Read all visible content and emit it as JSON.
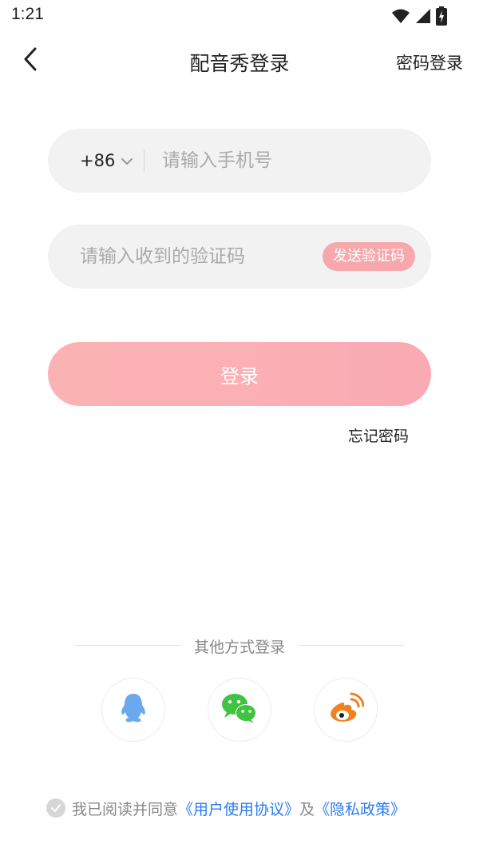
{
  "status_bar": {
    "time": "1:21"
  },
  "header": {
    "title": "配音秀登录",
    "right_action": "密码登录"
  },
  "form": {
    "country_code": "+86",
    "phone_placeholder": "请输入手机号",
    "code_placeholder": "请输入收到的验证码",
    "send_code_label": "发送验证码",
    "login_label": "登录",
    "forgot_label": "忘记密码"
  },
  "other_login": {
    "label": "其他方式登录",
    "providers": [
      "qq-icon",
      "wechat-icon",
      "weibo-icon"
    ]
  },
  "agreement": {
    "prefix": "我已阅读并同意",
    "user_agreement": "《用户使用协议》",
    "and": "及",
    "privacy_policy": "《隐私政策》"
  },
  "colors": {
    "accent_pink": "#f7a8ad",
    "login_gradient_start": "#fbb2b2",
    "login_gradient_end": "#f9aab3",
    "link_blue": "#2a7df0",
    "qq_blue": "#6aa9f0",
    "wechat_green": "#3fc340",
    "weibo_orange": "#f0821e",
    "field_bg": "#f2f2f2"
  }
}
